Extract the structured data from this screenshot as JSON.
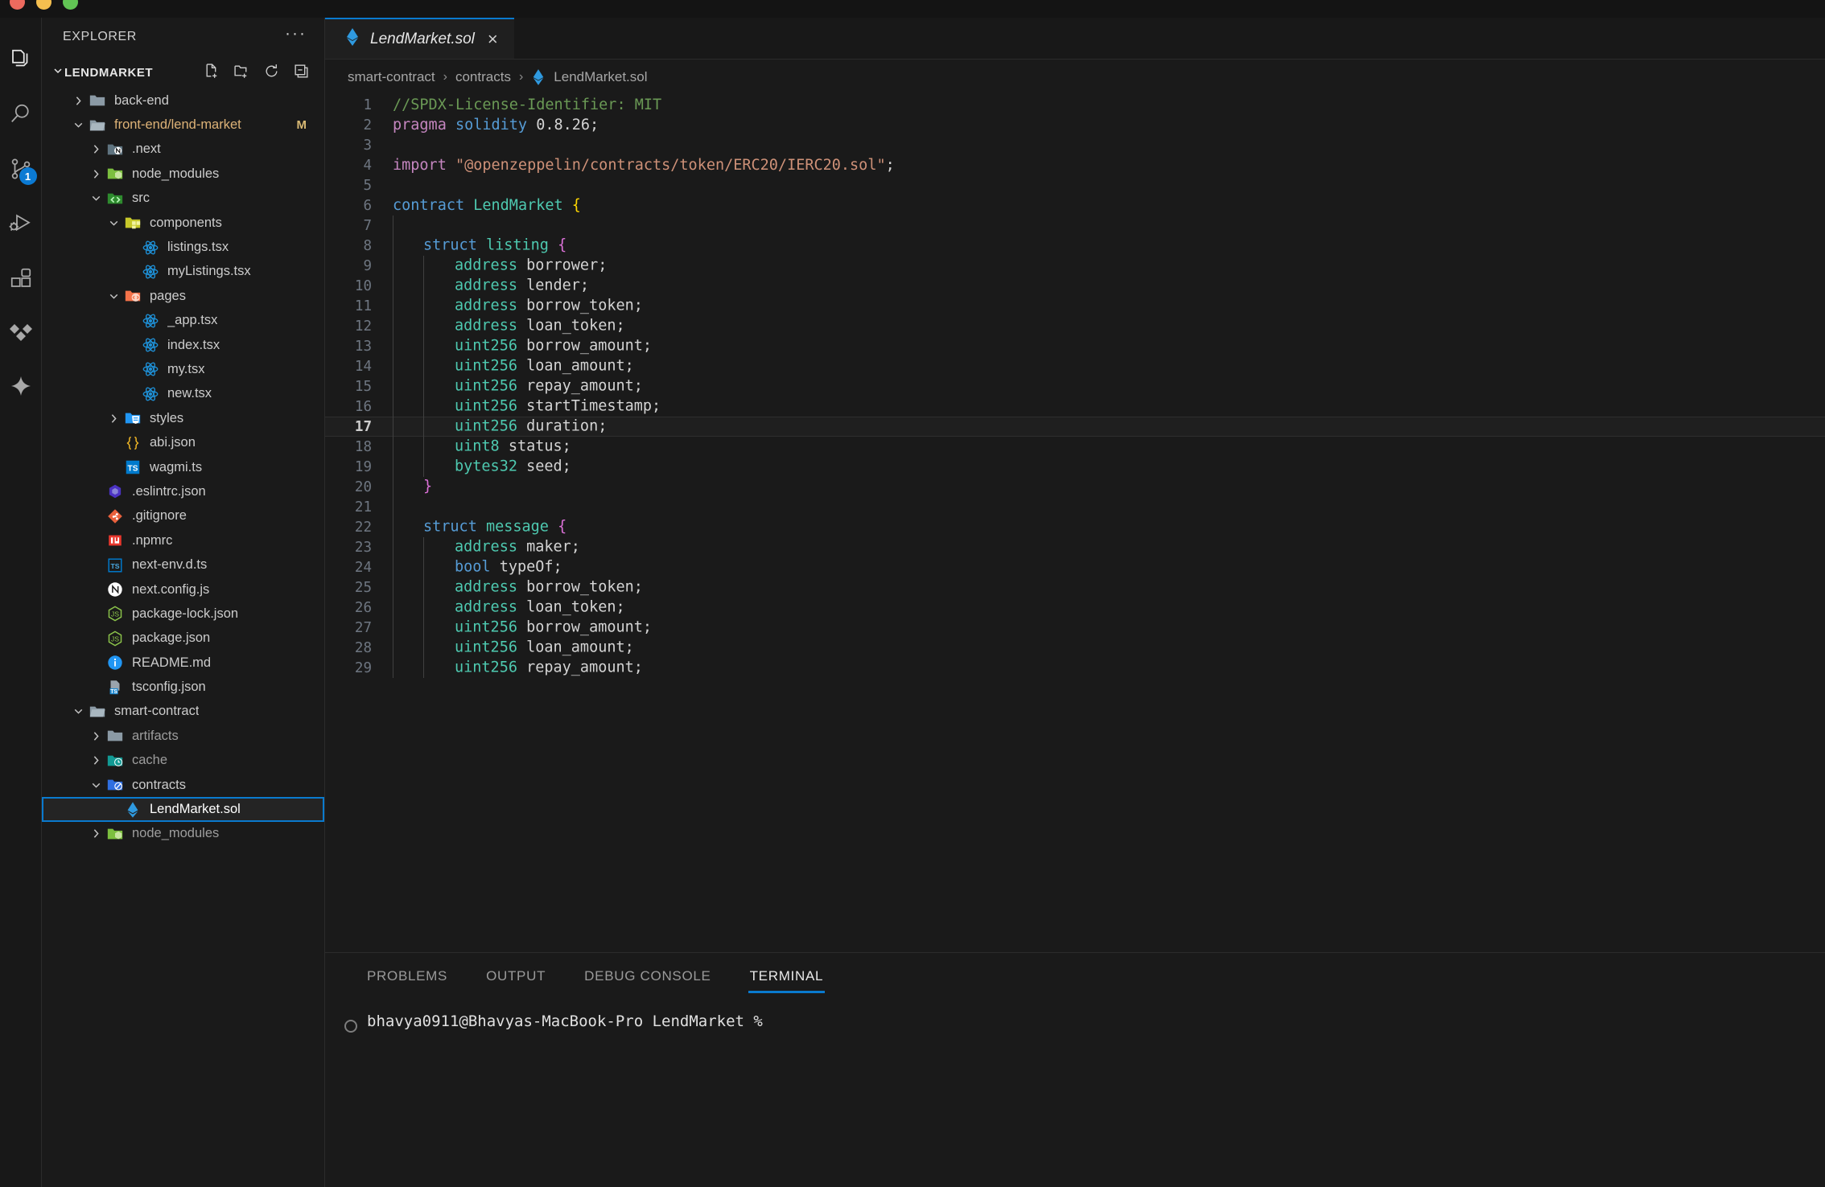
{
  "window": {
    "traffic_lights": [
      "close",
      "minimize",
      "zoom"
    ]
  },
  "activity_bar": {
    "items": [
      {
        "name": "explorer",
        "icon": "files-icon",
        "active": true,
        "badge": ""
      },
      {
        "name": "search",
        "icon": "search-icon",
        "active": false,
        "badge": ""
      },
      {
        "name": "source-control",
        "icon": "source-control-icon",
        "active": false,
        "badge": "1"
      },
      {
        "name": "run-and-debug",
        "icon": "run-debug-icon",
        "active": false,
        "badge": ""
      },
      {
        "name": "extensions",
        "icon": "extensions-icon",
        "active": false,
        "badge": ""
      },
      {
        "name": "testing",
        "icon": "diamonds-icon",
        "active": false,
        "badge": ""
      },
      {
        "name": "copilot",
        "icon": "sparkle-icon",
        "active": false,
        "badge": ""
      }
    ]
  },
  "sidebar": {
    "title": "EXPLORER",
    "more_actions": "···",
    "root": {
      "label": "LENDMARKET",
      "expanded": true,
      "actions": [
        "new-file-icon",
        "new-folder-icon",
        "refresh-icon",
        "collapse-all-icon"
      ]
    },
    "tree": [
      {
        "label": "back-end",
        "indent": 1,
        "kind": "folder",
        "icon": "folder-icon",
        "state": "collapsed",
        "badge": ""
      },
      {
        "label": "front-end/lend-market",
        "indent": 1,
        "kind": "folder",
        "icon": "folder-open-icon",
        "state": "expanded",
        "badge": "M",
        "name_color": "modified"
      },
      {
        "label": ".next",
        "indent": 2,
        "kind": "folder",
        "icon": "folder-next-icon",
        "state": "collapsed",
        "badge": ""
      },
      {
        "label": "node_modules",
        "indent": 2,
        "kind": "folder",
        "icon": "folder-node-icon",
        "state": "collapsed",
        "badge": ""
      },
      {
        "label": "src",
        "indent": 2,
        "kind": "folder",
        "icon": "folder-src-icon",
        "state": "expanded",
        "badge": ""
      },
      {
        "label": "components",
        "indent": 3,
        "kind": "folder",
        "icon": "folder-components-icon",
        "state": "expanded",
        "badge": ""
      },
      {
        "label": "listings.tsx",
        "indent": 4,
        "kind": "file",
        "icon": "react-icon",
        "state": "leaf",
        "badge": ""
      },
      {
        "label": "myListings.tsx",
        "indent": 4,
        "kind": "file",
        "icon": "react-icon",
        "state": "leaf",
        "badge": ""
      },
      {
        "label": "pages",
        "indent": 3,
        "kind": "folder",
        "icon": "folder-pages-icon",
        "state": "expanded",
        "badge": ""
      },
      {
        "label": "_app.tsx",
        "indent": 4,
        "kind": "file",
        "icon": "react-icon",
        "state": "leaf",
        "badge": ""
      },
      {
        "label": "index.tsx",
        "indent": 4,
        "kind": "file",
        "icon": "react-icon",
        "state": "leaf",
        "badge": ""
      },
      {
        "label": "my.tsx",
        "indent": 4,
        "kind": "file",
        "icon": "react-icon",
        "state": "leaf",
        "badge": ""
      },
      {
        "label": "new.tsx",
        "indent": 4,
        "kind": "file",
        "icon": "react-icon",
        "state": "leaf",
        "badge": ""
      },
      {
        "label": "styles",
        "indent": 3,
        "kind": "folder",
        "icon": "folder-css-icon",
        "state": "collapsed",
        "badge": ""
      },
      {
        "label": "abi.json",
        "indent": 3,
        "kind": "file",
        "icon": "json-icon",
        "state": "leaf",
        "badge": ""
      },
      {
        "label": "wagmi.ts",
        "indent": 3,
        "kind": "file",
        "icon": "typescript-icon",
        "state": "leaf",
        "badge": ""
      },
      {
        "label": ".eslintrc.json",
        "indent": 2,
        "kind": "file",
        "icon": "eslint-icon",
        "state": "leaf",
        "badge": ""
      },
      {
        "label": ".gitignore",
        "indent": 2,
        "kind": "file",
        "icon": "git-icon",
        "state": "leaf",
        "badge": ""
      },
      {
        "label": ".npmrc",
        "indent": 2,
        "kind": "file",
        "icon": "npm-icon",
        "state": "leaf",
        "badge": ""
      },
      {
        "label": "next-env.d.ts",
        "indent": 2,
        "kind": "file",
        "icon": "typescript-def-icon",
        "state": "leaf",
        "badge": ""
      },
      {
        "label": "next.config.js",
        "indent": 2,
        "kind": "file",
        "icon": "nextjs-icon",
        "state": "leaf",
        "badge": ""
      },
      {
        "label": "package-lock.json",
        "indent": 2,
        "kind": "file",
        "icon": "npm-json-icon",
        "state": "leaf",
        "badge": ""
      },
      {
        "label": "package.json",
        "indent": 2,
        "kind": "file",
        "icon": "npm-json-icon",
        "state": "leaf",
        "badge": ""
      },
      {
        "label": "README.md",
        "indent": 2,
        "kind": "file",
        "icon": "readme-icon",
        "state": "leaf",
        "badge": ""
      },
      {
        "label": "tsconfig.json",
        "indent": 2,
        "kind": "file",
        "icon": "tsconfig-icon",
        "state": "leaf",
        "badge": ""
      },
      {
        "label": "smart-contract",
        "indent": 1,
        "kind": "folder",
        "icon": "folder-open-icon",
        "state": "expanded",
        "badge": ""
      },
      {
        "label": "artifacts",
        "indent": 2,
        "kind": "folder",
        "icon": "folder-icon",
        "state": "collapsed",
        "badge": "",
        "dim": true
      },
      {
        "label": "cache",
        "indent": 2,
        "kind": "folder",
        "icon": "folder-cache-icon",
        "state": "collapsed",
        "badge": "",
        "dim": true
      },
      {
        "label": "contracts",
        "indent": 2,
        "kind": "folder",
        "icon": "folder-contracts-icon",
        "state": "expanded",
        "badge": ""
      },
      {
        "label": "LendMarket.sol",
        "indent": 3,
        "kind": "file",
        "icon": "solidity-icon",
        "state": "leaf",
        "badge": "",
        "selected": true
      },
      {
        "label": "node_modules",
        "indent": 2,
        "kind": "folder",
        "icon": "folder-node-icon",
        "state": "collapsed",
        "badge": "",
        "dim": true
      }
    ]
  },
  "editor": {
    "tabs": [
      {
        "label": "LendMarket.sol",
        "icon": "solidity-icon",
        "active": true,
        "close": "×",
        "italic": true
      }
    ],
    "breadcrumb": [
      {
        "label": "smart-contract",
        "icon": ""
      },
      {
        "label": "contracts",
        "icon": ""
      },
      {
        "label": "LendMarket.sol",
        "icon": "solidity-icon"
      }
    ],
    "breadcrumb_separator": "›",
    "current_line": 17,
    "lines": [
      {
        "n": 1,
        "tokens": [
          {
            "t": "//SPDX-License-Identifier: MIT",
            "c": "t-com"
          }
        ]
      },
      {
        "n": 2,
        "tokens": [
          {
            "t": "pragma",
            "c": "t-kw"
          },
          {
            "t": " ",
            "c": "t-var"
          },
          {
            "t": "solidity",
            "c": "t-kw2"
          },
          {
            "t": " ",
            "c": "t-var"
          },
          {
            "t": "0.8.26",
            "c": "t-num"
          },
          {
            "t": ";",
            "c": "t-var"
          }
        ]
      },
      {
        "n": 3,
        "tokens": []
      },
      {
        "n": 4,
        "tokens": [
          {
            "t": "import",
            "c": "t-kw"
          },
          {
            "t": " ",
            "c": "t-var"
          },
          {
            "t": "\"@openzeppelin/contracts/token/ERC20/IERC20.sol\"",
            "c": "t-str"
          },
          {
            "t": ";",
            "c": "t-var"
          }
        ]
      },
      {
        "n": 5,
        "tokens": []
      },
      {
        "n": 6,
        "tokens": [
          {
            "t": "contract",
            "c": "t-kw2"
          },
          {
            "t": " ",
            "c": "t-var"
          },
          {
            "t": "LendMarket",
            "c": "t-cls"
          },
          {
            "t": " ",
            "c": "t-var"
          },
          {
            "t": "{",
            "c": "t-br-y"
          }
        ]
      },
      {
        "n": 7,
        "tokens": [],
        "guides": 1
      },
      {
        "n": 8,
        "tokens": [
          {
            "t": "struct",
            "c": "t-kw2"
          },
          {
            "t": " ",
            "c": "t-var"
          },
          {
            "t": "listing",
            "c": "t-typ"
          },
          {
            "t": " ",
            "c": "t-var"
          },
          {
            "t": "{",
            "c": "t-br-p"
          }
        ],
        "guides": 1,
        "indent": 1
      },
      {
        "n": 9,
        "tokens": [
          {
            "t": "address",
            "c": "t-typ"
          },
          {
            "t": " borrower;",
            "c": "t-var"
          }
        ],
        "guides": 2,
        "indent": 2
      },
      {
        "n": 10,
        "tokens": [
          {
            "t": "address",
            "c": "t-typ"
          },
          {
            "t": " lender;",
            "c": "t-var"
          }
        ],
        "guides": 2,
        "indent": 2
      },
      {
        "n": 11,
        "tokens": [
          {
            "t": "address",
            "c": "t-typ"
          },
          {
            "t": " borrow_token;",
            "c": "t-var"
          }
        ],
        "guides": 2,
        "indent": 2
      },
      {
        "n": 12,
        "tokens": [
          {
            "t": "address",
            "c": "t-typ"
          },
          {
            "t": " loan_token;",
            "c": "t-var"
          }
        ],
        "guides": 2,
        "indent": 2
      },
      {
        "n": 13,
        "tokens": [
          {
            "t": "uint256",
            "c": "t-typ"
          },
          {
            "t": " borrow_amount;",
            "c": "t-var"
          }
        ],
        "guides": 2,
        "indent": 2
      },
      {
        "n": 14,
        "tokens": [
          {
            "t": "uint256",
            "c": "t-typ"
          },
          {
            "t": " loan_amount;",
            "c": "t-var"
          }
        ],
        "guides": 2,
        "indent": 2
      },
      {
        "n": 15,
        "tokens": [
          {
            "t": "uint256",
            "c": "t-typ"
          },
          {
            "t": " repay_amount;",
            "c": "t-var"
          }
        ],
        "guides": 2,
        "indent": 2
      },
      {
        "n": 16,
        "tokens": [
          {
            "t": "uint256",
            "c": "t-typ"
          },
          {
            "t": " startTimestamp;",
            "c": "t-var"
          }
        ],
        "guides": 2,
        "indent": 2
      },
      {
        "n": 17,
        "tokens": [
          {
            "t": "uint256",
            "c": "t-typ"
          },
          {
            "t": " duration;",
            "c": "t-var"
          }
        ],
        "guides": 2,
        "indent": 2,
        "current": true
      },
      {
        "n": 18,
        "tokens": [
          {
            "t": "uint8",
            "c": "t-typ"
          },
          {
            "t": " status;",
            "c": "t-var"
          }
        ],
        "guides": 2,
        "indent": 2
      },
      {
        "n": 19,
        "tokens": [
          {
            "t": "bytes32",
            "c": "t-typ"
          },
          {
            "t": " seed;",
            "c": "t-var"
          }
        ],
        "guides": 2,
        "indent": 2
      },
      {
        "n": 20,
        "tokens": [
          {
            "t": "}",
            "c": "t-br-p"
          }
        ],
        "guides": 1,
        "indent": 1
      },
      {
        "n": 21,
        "tokens": [],
        "guides": 1
      },
      {
        "n": 22,
        "tokens": [
          {
            "t": "struct",
            "c": "t-kw2"
          },
          {
            "t": " ",
            "c": "t-var"
          },
          {
            "t": "message",
            "c": "t-typ"
          },
          {
            "t": " ",
            "c": "t-var"
          },
          {
            "t": "{",
            "c": "t-br-p"
          }
        ],
        "guides": 1,
        "indent": 1
      },
      {
        "n": 23,
        "tokens": [
          {
            "t": "address",
            "c": "t-typ"
          },
          {
            "t": " maker;",
            "c": "t-var"
          }
        ],
        "guides": 2,
        "indent": 2
      },
      {
        "n": 24,
        "tokens": [
          {
            "t": "bool",
            "c": "t-kw2"
          },
          {
            "t": " typeOf;",
            "c": "t-var"
          }
        ],
        "guides": 2,
        "indent": 2
      },
      {
        "n": 25,
        "tokens": [
          {
            "t": "address",
            "c": "t-typ"
          },
          {
            "t": " borrow_token;",
            "c": "t-var"
          }
        ],
        "guides": 2,
        "indent": 2
      },
      {
        "n": 26,
        "tokens": [
          {
            "t": "address",
            "c": "t-typ"
          },
          {
            "t": " loan_token;",
            "c": "t-var"
          }
        ],
        "guides": 2,
        "indent": 2
      },
      {
        "n": 27,
        "tokens": [
          {
            "t": "uint256",
            "c": "t-typ"
          },
          {
            "t": " borrow_amount;",
            "c": "t-var"
          }
        ],
        "guides": 2,
        "indent": 2
      },
      {
        "n": 28,
        "tokens": [
          {
            "t": "uint256",
            "c": "t-typ"
          },
          {
            "t": " loan_amount;",
            "c": "t-var"
          }
        ],
        "guides": 2,
        "indent": 2
      },
      {
        "n": 29,
        "tokens": [
          {
            "t": "uint256",
            "c": "t-typ"
          },
          {
            "t": " repay_amount;",
            "c": "t-var"
          }
        ],
        "guides": 2,
        "indent": 2
      }
    ]
  },
  "panel": {
    "tabs": [
      {
        "label": "PROBLEMS",
        "active": false
      },
      {
        "label": "OUTPUT",
        "active": false
      },
      {
        "label": "DEBUG CONSOLE",
        "active": false
      },
      {
        "label": "TERMINAL",
        "active": true
      }
    ],
    "terminal": {
      "prompt": "bhavya0911@Bhavyas-MacBook-Pro LendMarket %"
    }
  },
  "colors": {
    "accent": "#0a7ace",
    "background": "#1a1a1a",
    "activity_bar": "#181818",
    "selected_row": "#242424",
    "modified": "#ddb277"
  }
}
